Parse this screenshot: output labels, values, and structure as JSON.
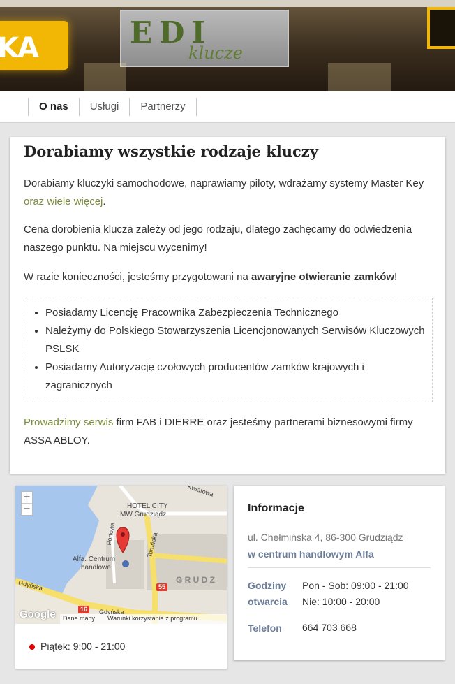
{
  "hero": {
    "left_sign_text": "KA",
    "sign_glyphs": "EDI",
    "sign_word": "klucze"
  },
  "nav": {
    "items": [
      {
        "label": "O nas",
        "active": true
      },
      {
        "label": "Usługi",
        "active": false
      },
      {
        "label": "Partnerzy",
        "active": false
      }
    ]
  },
  "main": {
    "title": "Dorabiamy wszystkie rodzaje kluczy",
    "p1_text": "Dorabiamy kluczyki samochodowe, naprawiamy piloty, wdrażamy systemy Master Key ",
    "p1_link": "oraz wiele więcej",
    "p1_end": ".",
    "p2": "Cena dorobienia klucza zależy od jego rodzaju, dlatego zachęcamy do odwiedzenia naszego punktu. Na miejscu wycenimy!",
    "p3_text": "W razie konieczności, jesteśmy przygotowani na ",
    "p3_bold": "awaryjne otwieranie zamków",
    "p3_end": "!",
    "features": [
      "Posiadamy Licencję Pracownika Zabezpieczenia Technicznego",
      "Należymy do Polskiego Stowarzyszenia Licencjonowanych Serwisów Kluczowych PSLSK",
      "Posiadamy Autoryzację czołowych producentów zamków krajowych i zagranicznych"
    ],
    "p4_link": "Prowadzimy serwis",
    "p4_text": " firm FAB i DIERRE oraz jesteśmy partnerami biznesowymi firmy ASSA ABLOY."
  },
  "map": {
    "zoom_in": "+",
    "zoom_out": "−",
    "labels": {
      "street_kwiatowa": "Kwiatowa",
      "hotel": "HOTEL CITY",
      "hotel_sub": "MW Grudziądz",
      "street_portowa": "Portowa",
      "street_torunska": "Toruńska",
      "alfa": "Alfa. Centrum",
      "alfa_sub": "handlowe",
      "city": "G R U D Z",
      "street_gdynska": "Gdyńska",
      "street_gdynska2": "Gdyńska",
      "road_16": "16",
      "road_55": "55"
    },
    "google": "Google",
    "attrib_data": "Dane mapy",
    "attrib_terms": "Warunki korzystania z programu",
    "hours_label": "Piątek: 9:00 - 21:00",
    "colors": {
      "water": "#a7c6ee",
      "road": "#f6df6a",
      "block": "#d4d0c8",
      "marker": "#e53935"
    }
  },
  "info": {
    "title": "Informacje",
    "address": "ul. Chełmińska 4, 86-300 Grudziądz",
    "address_note": "w centrum handlowym Alfa",
    "hours_label_1": "Godziny",
    "hours_label_2": "otwarcia",
    "hours_weekday": "Pon - Sob: 09:00 - 21:00",
    "hours_sunday": "Nie: 10:00 - 20:00",
    "phone_label": "Telefon",
    "phone": "664 703 668"
  }
}
